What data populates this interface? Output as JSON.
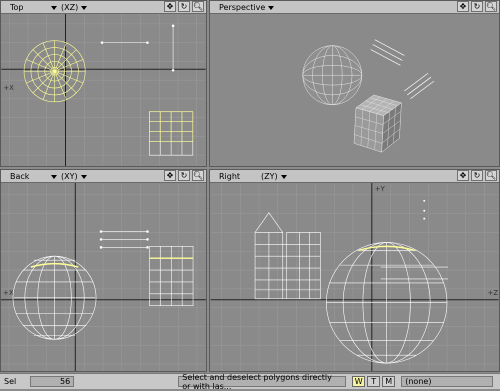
{
  "viewports": {
    "top": {
      "title": "Top",
      "axis": "(XZ)"
    },
    "perspective": {
      "title": "Perspective",
      "axis": ""
    },
    "back": {
      "title": "Back",
      "axis": "(XY)"
    },
    "right": {
      "title": "Right",
      "axis": "(ZY)"
    }
  },
  "tool_icons": [
    "move-view-icon",
    "rotate-view-icon",
    "zoom-view-icon"
  ],
  "axis_marks": {
    "x": "+X",
    "y": "+Y",
    "z": "+Z"
  },
  "status": {
    "sel_label": "Sel",
    "sel_count": "56",
    "help_text": "Select and deselect polygons directly or with las...",
    "w_label": "W",
    "t_label": "T",
    "m_label": "M",
    "surface_value": "(none)"
  },
  "colors": {
    "selected": "#ffff99",
    "wire": "#ffffff",
    "grid": "#9a9a9a",
    "axis": "#222222"
  }
}
